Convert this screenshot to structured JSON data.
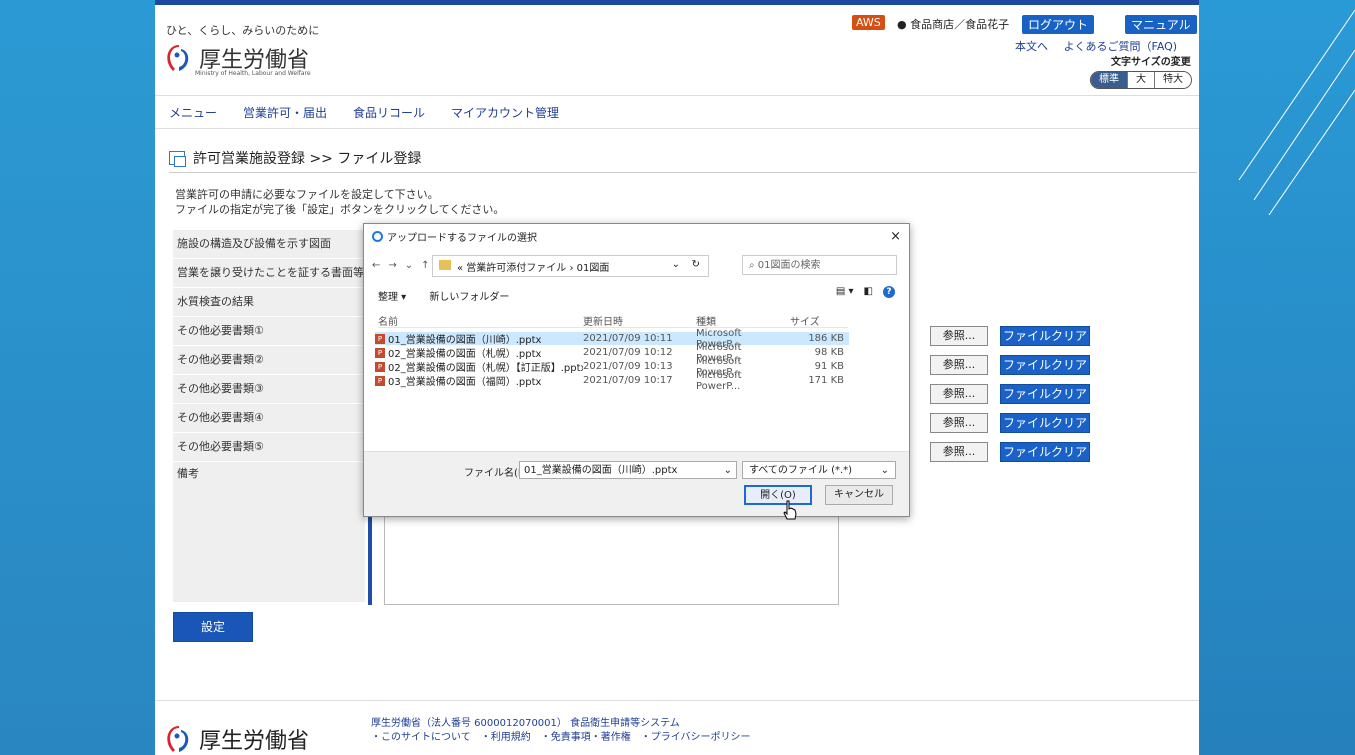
{
  "header": {
    "tagline": "ひと、くらし、みらいのために",
    "logo_text": "厚生労働省",
    "logo_sub": "Ministry of Health, Labour and Welfare",
    "aws_label": "AWS",
    "user_label": "食品商店／食品花子",
    "logout_label": "ログアウト",
    "manual_label": "マニュアル",
    "link_main": "本文へ",
    "link_faq": "よくあるご質問（FAQ)",
    "fontsize_label": "文字サイズの変更",
    "fontsize_std": "標準",
    "fontsize_mid": "大",
    "fontsize_big": "特大"
  },
  "nav": {
    "menu": "メニュー",
    "license": "営業許可・届出",
    "recall": "食品リコール",
    "account": "マイアカウント管理"
  },
  "section": {
    "title": "許可営業施設登録 >> ファイル登録",
    "instr1": "営業許可の申請に必要なファイルを設定して下さい。",
    "instr2": "ファイルの指定が完了後「設定」ボタンをクリックしてください。"
  },
  "rows": [
    "施設の構造及び設備を示す図面",
    "営業を譲り受けたことを証する書面等",
    "水質検査の結果",
    "その他必要書類①",
    "その他必要書類②",
    "その他必要書類③",
    "その他必要書類④",
    "その他必要書類⑤",
    "備考"
  ],
  "buttons": {
    "browse": "参照...",
    "clear": "ファイルクリア",
    "settei": "設定"
  },
  "footer": {
    "logo_text": "厚生労働省",
    "line1": "厚生労働省（法人番号 6000012070001）  食品衛生申請等システム",
    "line2": "・このサイトについて　・利用規約　・免責事項・著作権　・プライバシーポリシー"
  },
  "dialog": {
    "title": "アップロードするファイルの選択",
    "close": "×",
    "path": "«  営業許可添付ファイル  ›  01図面",
    "search_placeholder": "01図面の検索",
    "organize": "整理 ▾",
    "new_folder": "新しいフォルダー",
    "col_name": "名前",
    "col_date": "更新日時",
    "col_type": "種類",
    "col_size": "サイズ",
    "files": [
      {
        "name": "01_営業設備の図面（川崎）.pptx",
        "date": "2021/07/09 10:11",
        "type": "Microsoft PowerP...",
        "size": "186 KB"
      },
      {
        "name": "02_営業設備の図面（札幌）.pptx",
        "date": "2021/07/09 10:12",
        "type": "Microsoft PowerP...",
        "size": "98 KB"
      },
      {
        "name": "02_営業設備の図面（札幌）【訂正版】.pptx",
        "date": "2021/07/09 10:13",
        "type": "Microsoft PowerP...",
        "size": "91 KB"
      },
      {
        "name": "03_営業設備の図面（福岡）.pptx",
        "date": "2021/07/09 10:17",
        "type": "Microsoft PowerP...",
        "size": "171 KB"
      }
    ],
    "filename_label": "ファイル名(N):",
    "filename_value": "01_営業設備の図面（川崎）.pptx",
    "filetype_value": "すべてのファイル (*.*)",
    "open_label": "開く(O)",
    "cancel_label": "キャンセル"
  }
}
